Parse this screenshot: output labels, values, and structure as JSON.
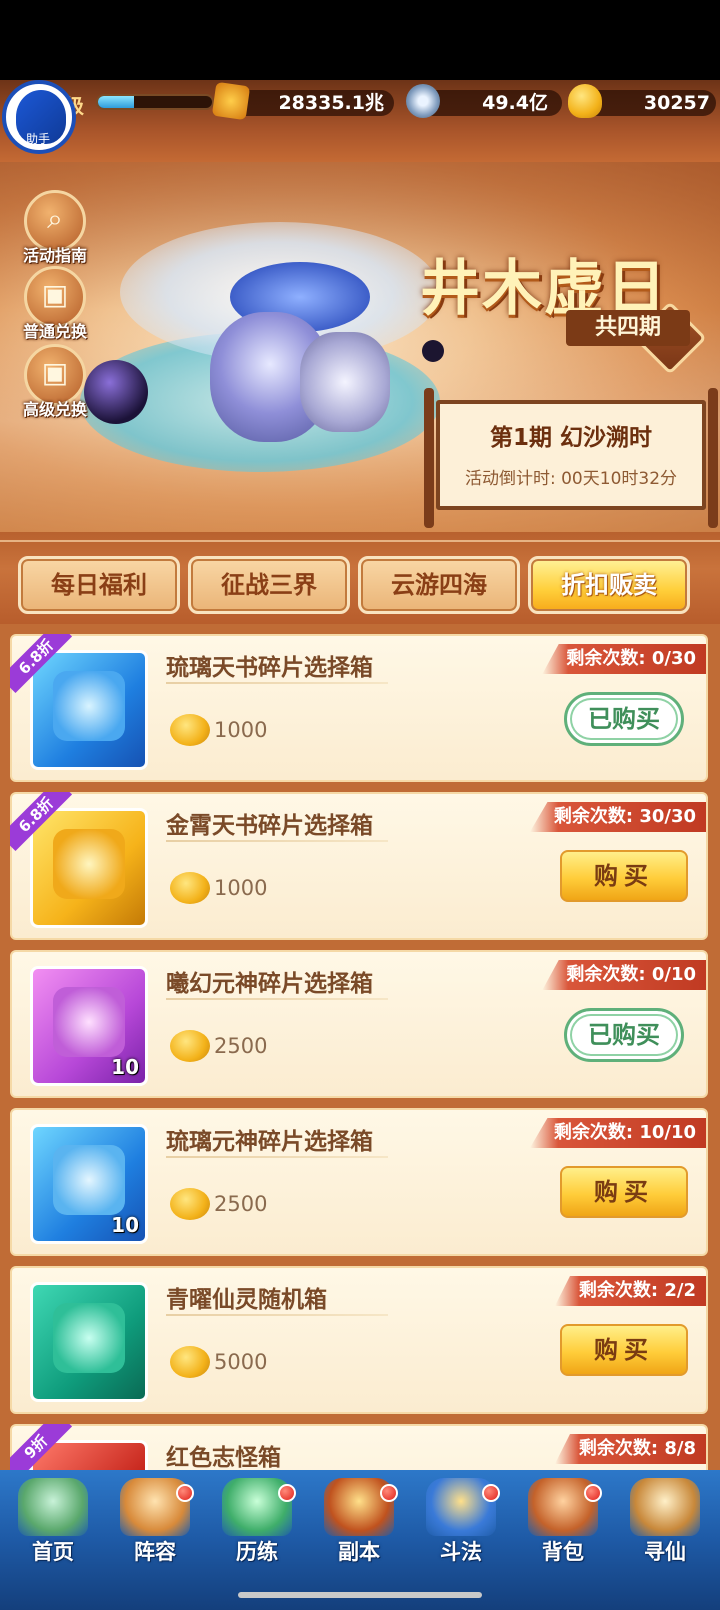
{
  "topbar": {
    "level_label": "级",
    "level_progress": 0.32,
    "power_icon": "battle-power-icon",
    "power_value": "28335.1兆",
    "silver_icon": "silver-coin-icon",
    "silver_value": "49.4亿",
    "gold_icon": "gold-ingot-icon",
    "gold_value": "30257",
    "helper_label": "助手"
  },
  "banner": {
    "title": "井木虚日",
    "subtitle": "共四期",
    "stage_name": "第1期  幻沙溯时",
    "countdown": "活动倒计时: 00天10时32分",
    "side_buttons": [
      {
        "label": "活动指南",
        "icon": "magnifier-icon"
      },
      {
        "label": "普通兑换",
        "icon": "gift-box-icon"
      },
      {
        "label": "高级兑换",
        "icon": "gift-box-icon"
      }
    ]
  },
  "tabs": [
    {
      "label": "每日福利",
      "active": false
    },
    {
      "label": "征战三界",
      "active": false
    },
    {
      "label": "云游四海",
      "active": false
    },
    {
      "label": "折扣贩卖",
      "active": true
    }
  ],
  "items": [
    {
      "name": "琉璃天书碎片选择箱",
      "price": "1000",
      "remain": "剩余次数: 0/30",
      "discount": "6.8折",
      "state": "bought",
      "button": "已购买",
      "count": ""
    },
    {
      "name": "金霄天书碎片选择箱",
      "price": "1000",
      "remain": "剩余次数: 30/30",
      "discount": "6.8折",
      "state": "buy",
      "button": "购买",
      "count": ""
    },
    {
      "name": "曦幻元神碎片选择箱",
      "price": "2500",
      "remain": "剩余次数: 0/10",
      "discount": "",
      "state": "bought",
      "button": "已购买",
      "count": "10"
    },
    {
      "name": "琉璃元神碎片选择箱",
      "price": "2500",
      "remain": "剩余次数: 10/10",
      "discount": "",
      "state": "buy",
      "button": "购买",
      "count": "10"
    },
    {
      "name": "青曜仙灵随机箱",
      "price": "5000",
      "remain": "剩余次数: 2/2",
      "discount": "",
      "state": "buy",
      "button": "购买",
      "count": ""
    },
    {
      "name": "红色志怪箱",
      "price": "",
      "remain": "剩余次数: 8/8",
      "discount": "9折",
      "state": "",
      "button": "",
      "count": ""
    }
  ],
  "nav": [
    {
      "label": "首页",
      "badge": false
    },
    {
      "label": "阵容",
      "badge": true
    },
    {
      "label": "历练",
      "badge": true
    },
    {
      "label": "副本",
      "badge": true
    },
    {
      "label": "斗法",
      "badge": true
    },
    {
      "label": "背包",
      "badge": true
    },
    {
      "label": "寻仙",
      "badge": false
    }
  ],
  "colors": {
    "accent_gold": "#ffcd3a",
    "discount_purple": "#9b3bd8",
    "bought_green": "#3f8f5a",
    "remain_red": "#c03a22",
    "nav_blue": "#1e5aa6"
  }
}
